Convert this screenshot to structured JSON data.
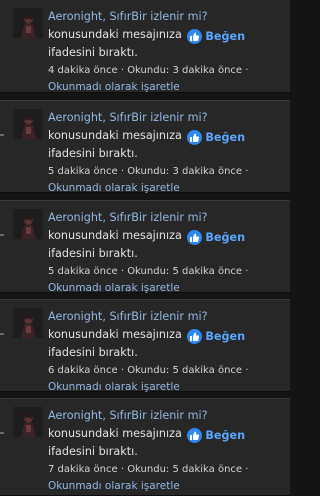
{
  "alerts": [
    {
      "user": "Aeronight",
      "thread": "SıfırBir izlenir mi?",
      "message_text": "konusundaki mesajınıza",
      "reaction": "Beğen",
      "reaction_icon": "thumbs-up-icon",
      "suffix": "ifadesini bıraktı.",
      "time": "4 dakika önce",
      "read_status": "Okundu: 3 dakika önce",
      "mark_unread": "Okunmadı olarak işaretle"
    },
    {
      "user": "Aeronight",
      "thread": "SıfırBir izlenir mi?",
      "message_text": "konusundaki mesajınıza",
      "reaction": "Beğen",
      "reaction_icon": "thumbs-up-icon",
      "suffix": "ifadesini bıraktı.",
      "time": "5 dakika önce",
      "read_status": "Okundu: 3 dakika önce",
      "mark_unread": "Okunmadı olarak işaretle"
    },
    {
      "user": "Aeronight",
      "thread": "SıfırBir izlenir mi?",
      "message_text": "konusundaki mesajınıza",
      "reaction": "Beğen",
      "reaction_icon": "thumbs-up-icon",
      "suffix": "ifadesini bıraktı.",
      "time": "5 dakika önce",
      "read_status": "Okundu: 5 dakika önce",
      "mark_unread": "Okunmadı olarak işaretle"
    },
    {
      "user": "Aeronight",
      "thread": "SıfırBir izlenir mi?",
      "message_text": "konusundaki mesajınıza",
      "reaction": "Beğen",
      "reaction_icon": "thumbs-up-icon",
      "suffix": "ifadesini bıraktı.",
      "time": "6 dakika önce",
      "read_status": "Okundu: 5 dakika önce",
      "mark_unread": "Okunmadı olarak işaretle"
    },
    {
      "user": "Aeronight",
      "thread": "SıfırBir izlenir mi?",
      "message_text": "konusundaki mesajınıza",
      "reaction": "Beğen",
      "reaction_icon": "thumbs-up-icon",
      "suffix": "ifadesini bıraktı.",
      "time": "7 dakika önce",
      "read_status": "Okundu: 5 dakika önce",
      "mark_unread": "Okunmadı olarak işaretle"
    }
  ],
  "meta_separator": "·",
  "colors": {
    "item_background": "#272727",
    "page_background": "#141414",
    "link": "#94b9e4",
    "reaction_badge": "#2f88f0",
    "reaction_label": "#5aa6ff",
    "text": "#e2e2e2"
  }
}
